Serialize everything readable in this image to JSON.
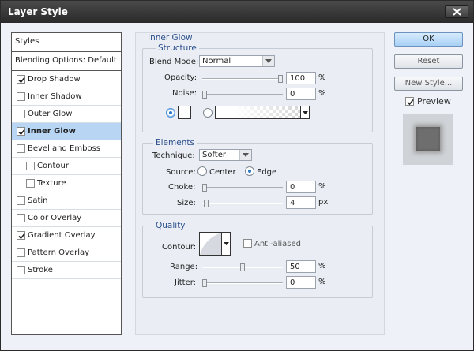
{
  "window": {
    "title": "Layer Style"
  },
  "styles_list": {
    "header": "Styles",
    "blending": "Blending Options: Default",
    "items": [
      {
        "label": "Drop Shadow",
        "checked": true,
        "indent": false,
        "selected": false
      },
      {
        "label": "Inner Shadow",
        "checked": false,
        "indent": false,
        "selected": false
      },
      {
        "label": "Outer Glow",
        "checked": false,
        "indent": false,
        "selected": false
      },
      {
        "label": "Inner Glow",
        "checked": true,
        "indent": false,
        "selected": true
      },
      {
        "label": "Bevel and Emboss",
        "checked": false,
        "indent": false,
        "selected": false
      },
      {
        "label": "Contour",
        "checked": false,
        "indent": true,
        "selected": false
      },
      {
        "label": "Texture",
        "checked": false,
        "indent": true,
        "selected": false
      },
      {
        "label": "Satin",
        "checked": false,
        "indent": false,
        "selected": false
      },
      {
        "label": "Color Overlay",
        "checked": false,
        "indent": false,
        "selected": false
      },
      {
        "label": "Gradient Overlay",
        "checked": true,
        "indent": false,
        "selected": false
      },
      {
        "label": "Pattern Overlay",
        "checked": false,
        "indent": false,
        "selected": false
      },
      {
        "label": "Stroke",
        "checked": false,
        "indent": false,
        "selected": false
      }
    ]
  },
  "inner_glow": {
    "title": "Inner Glow",
    "structure": {
      "title": "Structure",
      "blend_mode_label": "Blend Mode:",
      "blend_mode_value": "Normal",
      "opacity_label": "Opacity:",
      "opacity_value": "100",
      "opacity_percent": 100,
      "noise_label": "Noise:",
      "noise_value": "0",
      "noise_percent": 0,
      "unit_percent": "%",
      "color_swatch": "#ffffff"
    },
    "elements": {
      "title": "Elements",
      "technique_label": "Technique:",
      "technique_value": "Softer",
      "source_label": "Source:",
      "source_center": "Center",
      "source_edge": "Edge",
      "source_selected": "Edge",
      "choke_label": "Choke:",
      "choke_value": "0",
      "choke_percent": 0,
      "size_label": "Size:",
      "size_value": "4",
      "size_percent": 2,
      "unit_px": "px"
    },
    "quality": {
      "title": "Quality",
      "contour_label": "Contour:",
      "anti_aliased_label": "Anti-aliased",
      "anti_aliased_checked": false,
      "range_label": "Range:",
      "range_value": "50",
      "range_percent": 50,
      "jitter_label": "Jitter:",
      "jitter_value": "0",
      "jitter_percent": 0
    }
  },
  "buttons": {
    "ok": "OK",
    "reset": "Reset",
    "new_style": "New Style...",
    "preview_label": "Preview",
    "preview_checked": true
  },
  "colors": {
    "accent_legend": "#2b4f8c",
    "selection": "#b8d6f4"
  }
}
